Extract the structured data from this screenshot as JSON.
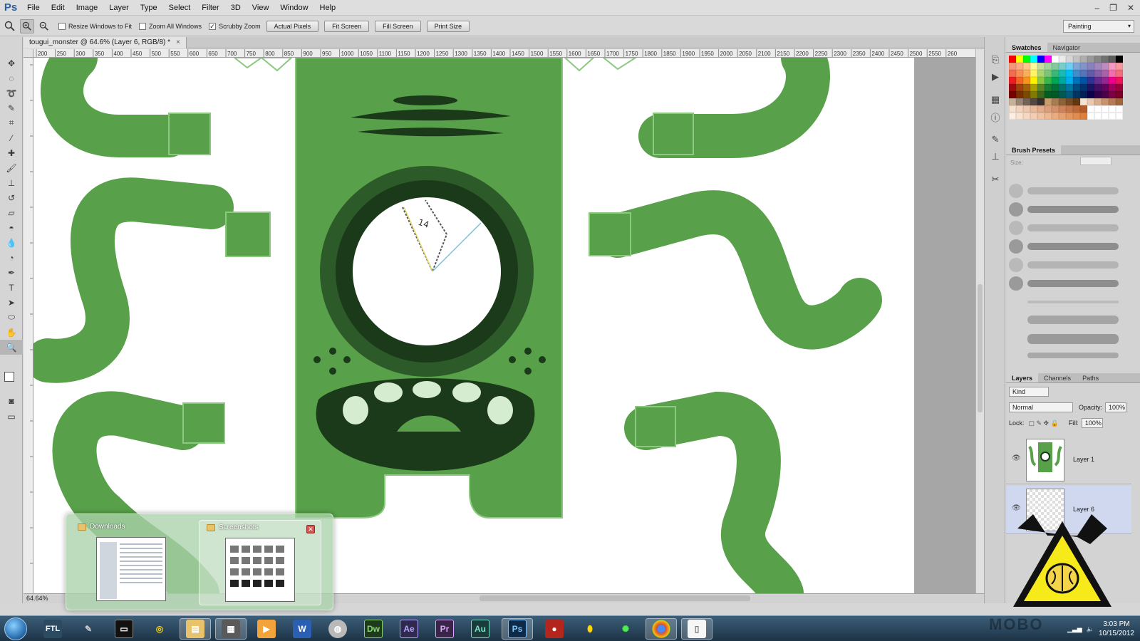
{
  "app": {
    "logo": "Ps"
  },
  "menu": [
    "File",
    "Edit",
    "Image",
    "Layer",
    "Type",
    "Select",
    "Filter",
    "3D",
    "View",
    "Window",
    "Help"
  ],
  "window_controls": [
    "–",
    "❐",
    "✕"
  ],
  "options": {
    "checks": [
      {
        "label": "Resize Windows to Fit",
        "checked": false
      },
      {
        "label": "Zoom All Windows",
        "checked": false
      },
      {
        "label": "Scrubby Zoom",
        "checked": true
      }
    ],
    "buttons": [
      "Actual Pixels",
      "Fit Screen",
      "Fill Screen",
      "Print Size"
    ],
    "workspace": "Painting"
  },
  "document": {
    "tab_title": "tougui_monster @ 64.6% (Layer 6, RGB/8) *",
    "zoom": "64.64%"
  },
  "ruler": {
    "top_ticks": [
      "200",
      "250",
      "300",
      "350",
      "400",
      "450",
      "500",
      "550",
      "600",
      "650",
      "700",
      "750",
      "800",
      "850",
      "900",
      "950",
      "1000",
      "1050",
      "1100",
      "1150",
      "1200",
      "1250",
      "1300",
      "1350",
      "1400",
      "1450",
      "1500",
      "1550",
      "1600",
      "1650",
      "1700",
      "1750",
      "1800",
      "1850",
      "1900",
      "1950",
      "2000",
      "2050",
      "2100",
      "2150",
      "2200",
      "2250",
      "2300",
      "2350",
      "2400",
      "2450",
      "2500",
      "2550",
      "260"
    ]
  },
  "canvas_art": {
    "clock_number": "14",
    "green": "#58a14a",
    "dark_green": "#1b3a1a",
    "light_green": "#8bc97f"
  },
  "panels": {
    "swatches_tabs": [
      "Swatches",
      "Navigator"
    ],
    "brush_tab": "Brush Presets",
    "brush_size_label": "Size:",
    "layers_tabs": [
      "Layers",
      "Channels",
      "Paths"
    ],
    "kind": "Kind",
    "blend_mode": "Normal",
    "opacity_label": "Opacity:",
    "opacity": "100%",
    "lock_label": "Lock:",
    "fill_label": "Fill:",
    "fill": "100%",
    "layers": [
      {
        "name": "Layer 1",
        "selected": false
      },
      {
        "name": "Layer 6",
        "selected": true
      }
    ]
  },
  "taskbar_preview": {
    "items": [
      "Downloads",
      "Screenshots"
    ],
    "close_glyph": "✕"
  },
  "taskbar": {
    "apps": [
      "FTL",
      "",
      "",
      "",
      "",
      "",
      "",
      "W",
      "",
      "Dw",
      "Ae",
      "Pr",
      "Au",
      "Ps",
      "",
      "",
      "",
      "",
      ""
    ],
    "clock_time": "3:03 PM",
    "clock_date": "10/15/2012",
    "watermark": "MOBO"
  }
}
